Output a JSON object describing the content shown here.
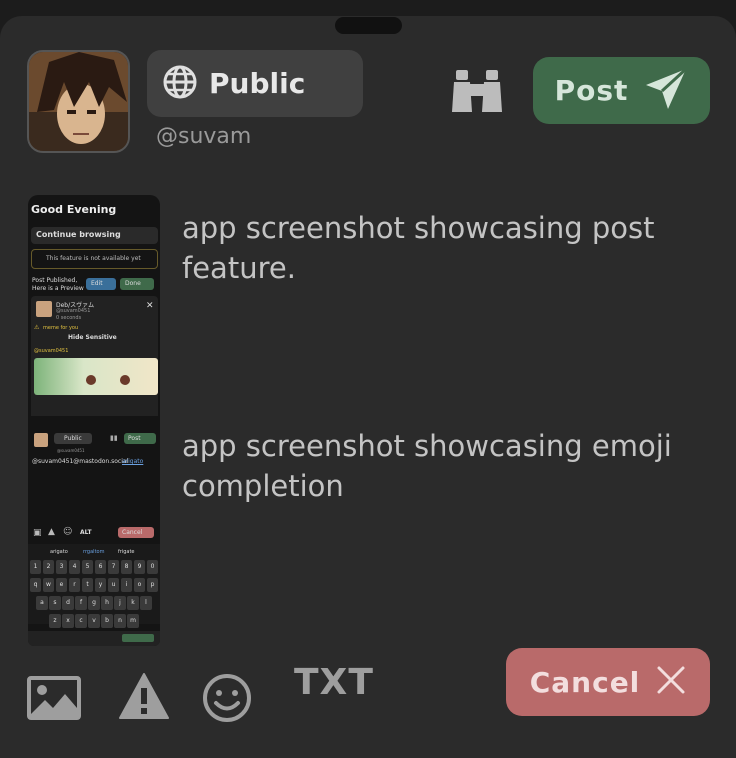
{
  "composer": {
    "visibility_label": "Public",
    "account_handle": "@suvam",
    "post_label": "Post",
    "cancel_label": "Cancel",
    "txt_label": "TXT"
  },
  "attachments": [
    {
      "description": "app screenshot showcasing post feature."
    },
    {
      "description": "app screenshot showcasing emoji completion"
    }
  ],
  "thumb1": {
    "greeting": "Good Evening",
    "continue": "Continue browsing",
    "notice": "This feature is not available yet",
    "published": "Post Published,",
    "preview": "Here is a Preview",
    "edit": "Edit",
    "done": "Done",
    "name": "Deb/スヴァム",
    "handle": "@suvam0451",
    "time": "0 seconds",
    "cw": "meme for you",
    "hide": "Hide Sensitive",
    "mention": "@suvam0451"
  },
  "thumb2": {
    "public": "Public",
    "post": "Post",
    "handle": "@suvam0451",
    "text_prefix": "@suvam0451@mastodon.social",
    "text_link": "arigato",
    "alt": "ALT",
    "cancel": "Cancel",
    "sugg": [
      "arigato",
      "rrgaltom",
      "frigate"
    ],
    "row1": [
      "1",
      "2",
      "3",
      "4",
      "5",
      "6",
      "7",
      "8",
      "9",
      "0"
    ],
    "row2": [
      "q",
      "w",
      "e",
      "r",
      "t",
      "y",
      "u",
      "i",
      "o",
      "p"
    ],
    "row3": [
      "a",
      "s",
      "d",
      "f",
      "g",
      "h",
      "j",
      "k",
      "l"
    ],
    "row4": [
      "z",
      "x",
      "c",
      "v",
      "b",
      "n",
      "m"
    ]
  },
  "colors": {
    "sheet": "#2b2b2b",
    "post_button": "#3f6a4a",
    "cancel_button": "#b96a6a"
  },
  "icons": [
    "globe-icon",
    "binoculars-icon",
    "send-icon",
    "image-icon",
    "warning-icon",
    "emoji-icon",
    "close-icon"
  ]
}
